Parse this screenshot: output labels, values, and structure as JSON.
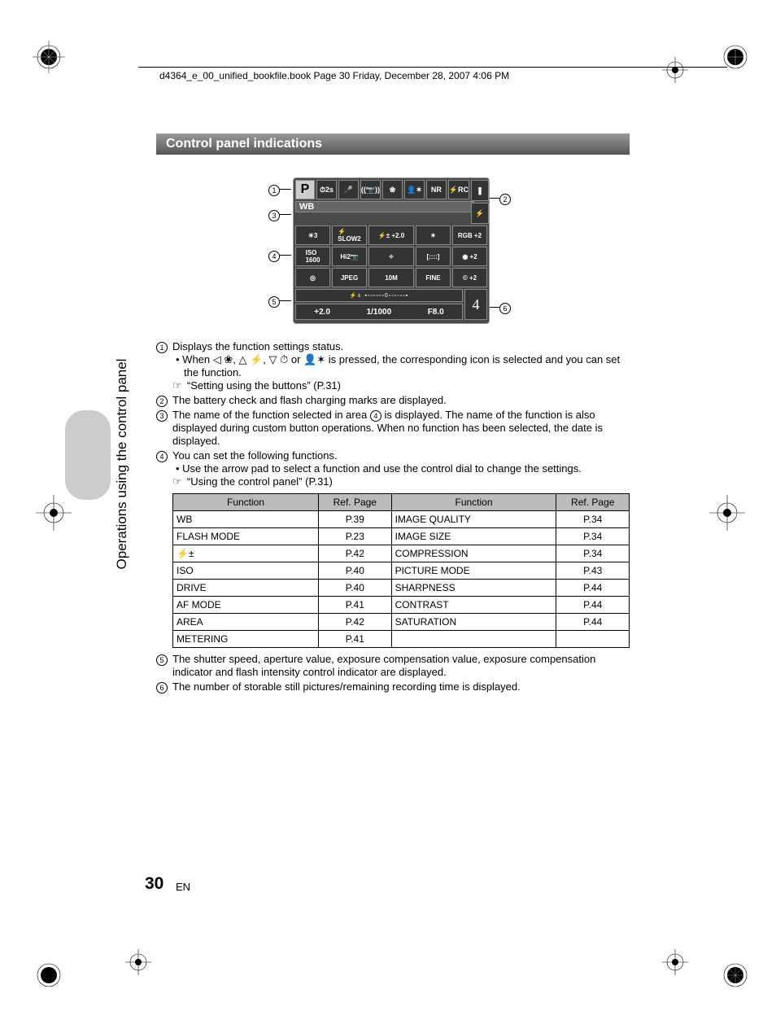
{
  "header": "d4364_e_00_unified_bookfile.book  Page 30  Friday, December 28, 2007  4:06 PM",
  "section_title": "Control panel indications",
  "callouts": {
    "c1": "1",
    "c2": "2",
    "c3": "3",
    "c4": "4",
    "c5": "5",
    "c6": "6"
  },
  "panel": {
    "mode": "P",
    "top_icons": [
      "⏱2s",
      "🎤",
      "((📷))",
      "❀",
      "👤✶",
      "NR",
      "⚡RC"
    ],
    "batt_icons": [
      "❚",
      "⚡"
    ],
    "wb_label": "WB",
    "grid": [
      [
        "☀3",
        "⚡\nSLOW2",
        "⚡±  +2.0",
        "✶",
        "RGB +2"
      ],
      [
        "ISO\n1600",
        "Hi2📷",
        "✧",
        "[::::]",
        "◉ +2"
      ],
      [
        "◎",
        "JPEG",
        "10M",
        "FINE",
        "© +2"
      ]
    ],
    "status_indicator": "▪▫▫▫▫▫▫0▫▫▫▫▫▫▪",
    "status_vals": [
      "+2.0",
      "1/1000",
      "F8.0"
    ],
    "shots": "4"
  },
  "items": [
    {
      "n": "1",
      "text": "Displays the function settings status.",
      "sub_bullet": "When ◁ ❀, △ ⚡, ▽ ⏱ or 👤✶ is pressed, the corresponding icon is selected and you can set the function.",
      "ref": "“Setting using the buttons” (P.31)"
    },
    {
      "n": "2",
      "text": "The battery check and flash charging marks are displayed."
    },
    {
      "n": "3",
      "text_pre": "The name of the function selected in area ",
      "text_num": "4",
      "text_post": " is displayed. The name of the function is also displayed during custom button operations. When no function has been selected, the date is displayed."
    },
    {
      "n": "4",
      "text": "You can set the following functions.",
      "sub_bullet": "Use the arrow pad to select a function and use the control dial to change the settings.",
      "ref": "“Using the control panel” (P.31)"
    },
    {
      "n": "5",
      "text": "The shutter speed, aperture value, exposure compensation value, exposure compensation indicator and flash intensity control indicator are displayed."
    },
    {
      "n": "6",
      "text": "The number of storable still pictures/remaining recording time is displayed."
    }
  ],
  "table": {
    "headers": [
      "Function",
      "Ref. Page",
      "Function",
      "Ref. Page"
    ],
    "rows": [
      [
        "WB",
        "P.39",
        "IMAGE QUALITY",
        "P.34"
      ],
      [
        "FLASH MODE",
        "P.23",
        "IMAGE SIZE",
        "P.34"
      ],
      [
        "⚡±",
        "P.42",
        "COMPRESSION",
        "P.34"
      ],
      [
        "ISO",
        "P.40",
        "PICTURE MODE",
        "P.43"
      ],
      [
        "DRIVE",
        "P.40",
        "SHARPNESS",
        "P.44"
      ],
      [
        "AF MODE",
        "P.41",
        "CONTRAST",
        "P.44"
      ],
      [
        "AREA",
        "P.42",
        "SATURATION",
        "P.44"
      ],
      [
        "METERING",
        "P.41",
        "",
        ""
      ]
    ]
  },
  "side_label": "Operations using the control panel",
  "page_number": "30",
  "page_lang": "EN",
  "chart_data": null
}
